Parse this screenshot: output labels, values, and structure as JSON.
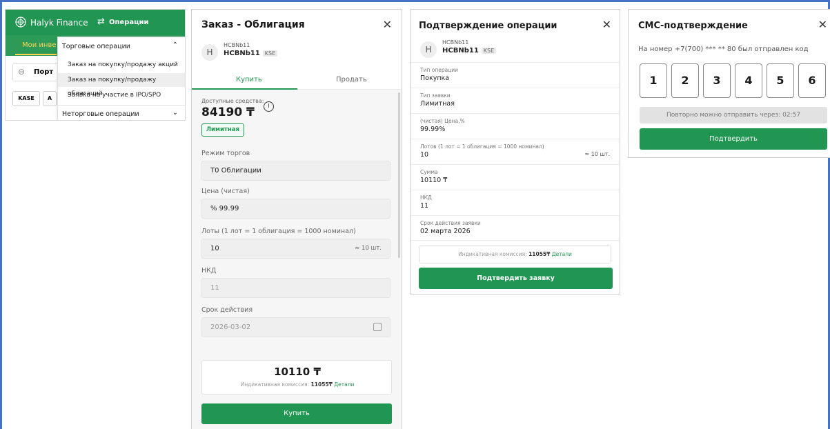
{
  "colors": {
    "brand_green": "#219653",
    "accent_yellow": "#ffd54d",
    "frame_blue": "#4472c4"
  },
  "nav": {
    "brand": "Halyk Finance",
    "operations": "Операции",
    "tab": "Мои инве",
    "portfolio": "Порт",
    "exchange": "KASE",
    "exchange2": "A",
    "menu": {
      "header": "Торговые операции",
      "items": [
        "Заказ на покупку/продажу акций",
        "Заказ на покупку/продажу облигаций",
        "Заявка на участие в IPO/SPO"
      ],
      "footer": "Неторговые операции"
    }
  },
  "order": {
    "title": "Заказ - Облигация",
    "avatar": "H",
    "ticker_top": "HCBNb11",
    "ticker": "HCBNb11",
    "exchange": "KSE",
    "tab_buy": "Купить",
    "tab_sell": "Продать",
    "available_label": "Доступные средства:",
    "available": "84190 ₸",
    "info_icon": "i",
    "order_type": "Лимитная",
    "mode_label": "Режим торгов",
    "mode": "Т0 Облигации",
    "price_label": "Цена (чистая)",
    "price": "%  99.99",
    "lots_label": "Лоты (1 лот = 1 облигация = 1000 номинал)",
    "lots": "10",
    "lots_right": "≈ 10 шт.",
    "nkd_label": "НКД",
    "nkd": "11",
    "expiry_label": "Срок действия",
    "expiry": "2026-03-02",
    "total": "10110 ₸",
    "commission_prefix": "Индикативная комиссия: ",
    "commission_value": "11055₸",
    "details": "Детали",
    "buy_button": "Купить"
  },
  "confirm": {
    "title": "Подтверждение операции",
    "avatar": "H",
    "ticker_top": "HCBNb11",
    "ticker": "HCBNb11",
    "exchange": "KSE",
    "rows": [
      {
        "label": "Тип операции",
        "value": "Покупка"
      },
      {
        "label": "Тип заявки",
        "value": "Лимитная"
      },
      {
        "label": "(чистая) Цена,%",
        "value": "99.99%"
      },
      {
        "label": "Лотов (1 лот = 1 облигация = 1000 номинал)",
        "value": "10",
        "right": "≈ 10 шт."
      },
      {
        "label": "Сумма",
        "value": "10110 ₸"
      },
      {
        "label": "НКД",
        "value": "11"
      },
      {
        "label": "Срок действия заявки",
        "value": "02 марта 2026"
      }
    ],
    "commission_prefix": "Индикативная комиссия: ",
    "commission_value": "11055₸",
    "details": "Детали",
    "button": "Подтвердить заявку"
  },
  "sms": {
    "title": "СМС-подтверждение",
    "sent_text": "На номер +7(700) *** ** 80 был отправлен код",
    "digits": [
      "1",
      "2",
      "3",
      "4",
      "5",
      "6"
    ],
    "resend": "Повторно можно отправить через: 02:57",
    "button": "Подтвердить"
  },
  "icons": {
    "close": "close-icon",
    "calendar": "calendar-icon",
    "info": "info-icon",
    "link": "link-icon",
    "chevron": "chevron-icon",
    "logo": "halyk-logo-icon",
    "swap": "swap-arrows-icon"
  }
}
